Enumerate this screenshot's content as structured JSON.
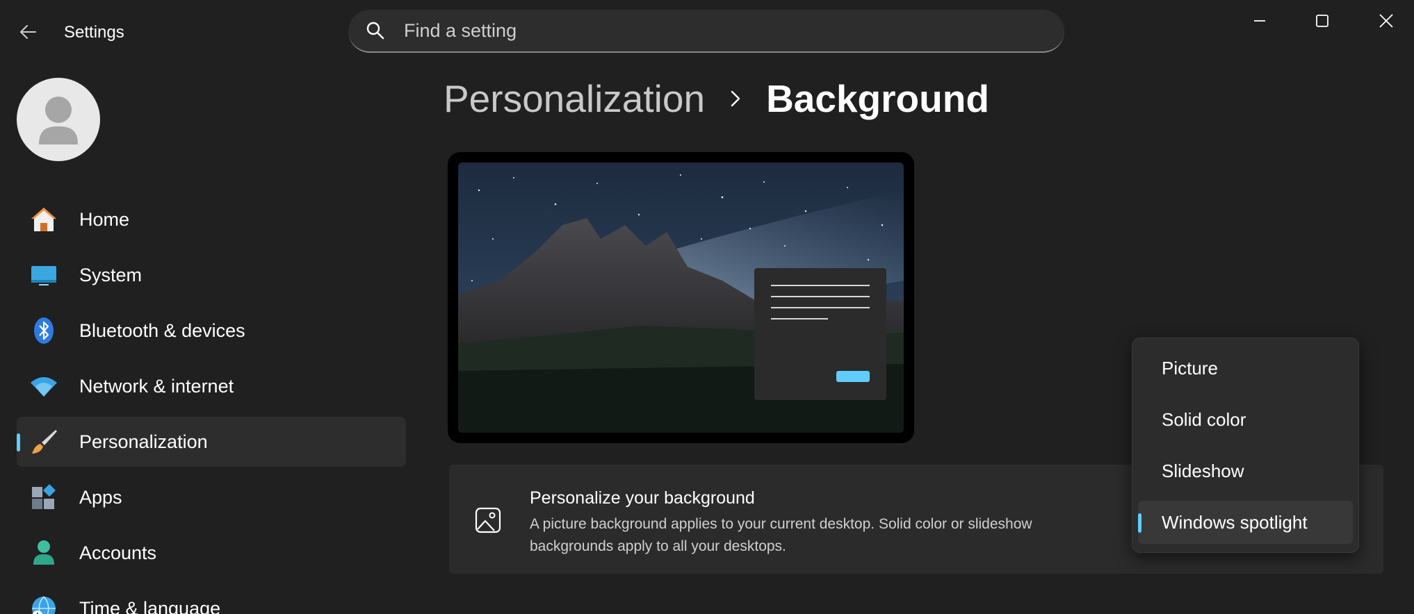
{
  "window": {
    "title": "Settings"
  },
  "search": {
    "placeholder": "Find a setting"
  },
  "sidebar": {
    "items": [
      {
        "label": "Home",
        "icon": "home-icon"
      },
      {
        "label": "System",
        "icon": "system-icon"
      },
      {
        "label": "Bluetooth & devices",
        "icon": "bluetooth-icon"
      },
      {
        "label": "Network & internet",
        "icon": "wifi-icon"
      },
      {
        "label": "Personalization",
        "icon": "paintbrush-icon",
        "active": true
      },
      {
        "label": "Apps",
        "icon": "apps-icon"
      },
      {
        "label": "Accounts",
        "icon": "accounts-icon"
      },
      {
        "label": "Time & language",
        "icon": "globe-clock-icon"
      }
    ]
  },
  "breadcrumb": {
    "parent": "Personalization",
    "current": "Background"
  },
  "card": {
    "title": "Personalize your background",
    "description": "A picture background applies to your current desktop. Solid color or slideshow backgrounds apply to all your desktops."
  },
  "dropdown": {
    "options": [
      "Picture",
      "Solid color",
      "Slideshow",
      "Windows spotlight"
    ],
    "selected": "Windows spotlight"
  },
  "colors": {
    "accent": "#60cdff",
    "background": "#202020",
    "card": "#2b2b2b"
  }
}
